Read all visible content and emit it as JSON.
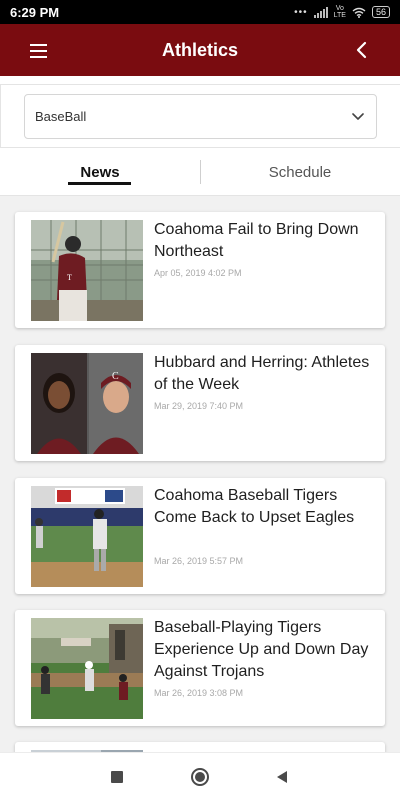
{
  "status_bar": {
    "time": "6:29 PM",
    "network_top": "Vo",
    "network_bottom": "LTE",
    "battery": "56"
  },
  "header": {
    "title": "Athletics",
    "menu_icon": "hamburger-menu-icon",
    "back_icon": "chevron-left-icon"
  },
  "filter": {
    "selected_sport": "BaseBall",
    "icon": "chevron-down-icon"
  },
  "tabs": [
    {
      "label": "News",
      "active": true
    },
    {
      "label": "Schedule",
      "active": false
    }
  ],
  "news": [
    {
      "title": "Coahoma Fail to Bring Down Northeast",
      "date": "Apr 05, 2019 4:02 PM"
    },
    {
      "title": "Hubbard and Herring: Athletes of the Week",
      "date": "Mar 29, 2019 7:40 PM"
    },
    {
      "title": "Coahoma Baseball Tigers Come Back to Upset Eagles",
      "date": "Mar 26, 2019 5:57 PM"
    },
    {
      "title": "Baseball-Playing Tigers Experience Up and Down Day Against Trojans",
      "date": "Mar 26, 2019 3:08 PM"
    }
  ],
  "colors": {
    "brand": "#7a0c10",
    "status_bar": "#000000",
    "background": "#f1f1f1"
  },
  "nav": {
    "recents_icon": "square-recents-icon",
    "home_icon": "circle-home-icon",
    "back_icon": "triangle-back-icon"
  }
}
